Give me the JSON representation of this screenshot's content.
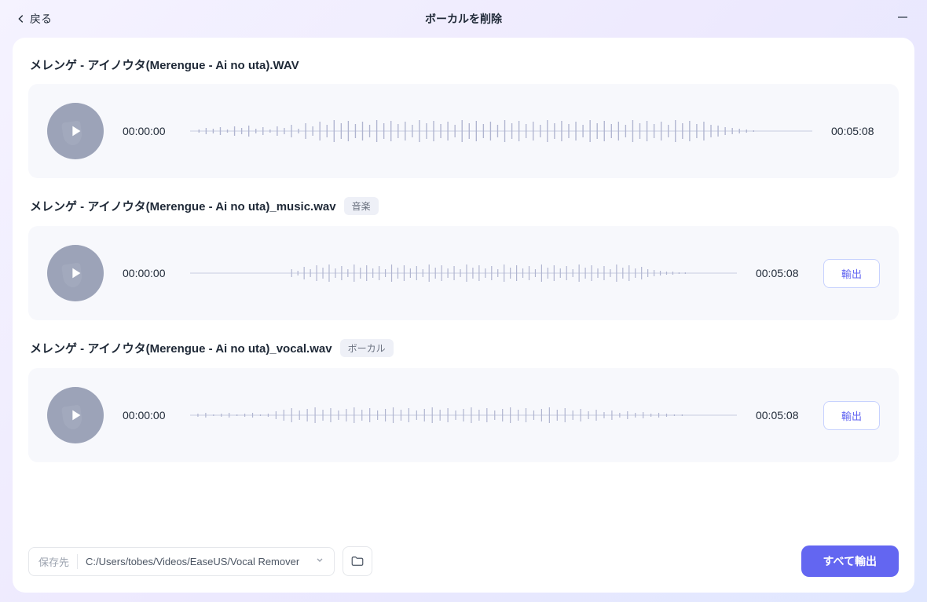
{
  "header": {
    "back_label": "戻る",
    "title": "ボーカルを削除"
  },
  "tracks": [
    {
      "title": "メレンゲ - アイノウタ(Merengue - Ai no uta).WAV",
      "tag": null,
      "current_time": "00:00:00",
      "duration": "00:05:08",
      "exportable": false
    },
    {
      "title": "メレンゲ - アイノウタ(Merengue - Ai no uta)_music.wav",
      "tag": "音楽",
      "current_time": "00:00:00",
      "duration": "00:05:08",
      "exportable": true
    },
    {
      "title": "メレンゲ - アイノウタ(Merengue - Ai no uta)_vocal.wav",
      "tag": "ボーカル",
      "current_time": "00:00:00",
      "duration": "00:05:08",
      "exportable": true
    }
  ],
  "labels": {
    "export": "輸出",
    "export_all": "すべて輸出"
  },
  "footer": {
    "save_label": "保存先",
    "save_path": "C:/Users/tobes/Videos/EaseUS/Vocal Remover"
  }
}
